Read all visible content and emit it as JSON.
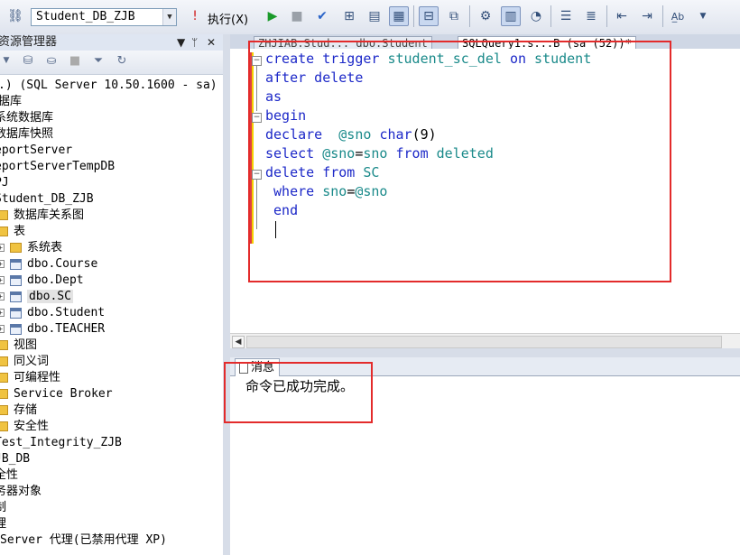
{
  "toolbar": {
    "database_selected": "Student_DB_ZJB",
    "execute_label": "执行(X)",
    "icons": [
      "connect-icon",
      "execute-icon",
      "debug-icon",
      "stop-icon",
      "parse-icon",
      "display-plan-icon",
      "query-options-icon",
      "results-grid-icon",
      "results-text-icon",
      "results-file-icon",
      "include-plan-icon",
      "client-stats-icon",
      "comment-icon",
      "uncomment-icon",
      "indent-icon",
      "outdent-icon",
      "specify-values-icon"
    ]
  },
  "object_explorer": {
    "title": "资源管理器",
    "tree": [
      {
        "label": ".) (SQL Server 10.50.1600 - sa)",
        "type": "server"
      },
      {
        "label": "据库",
        "type": "folder"
      },
      {
        "label": "系统数据库",
        "type": "folder"
      },
      {
        "label": "数据库快照",
        "type": "folder"
      },
      {
        "label": "eportServer",
        "type": "db"
      },
      {
        "label": "eportServerTempDB",
        "type": "db"
      },
      {
        "label": "PJ",
        "type": "db"
      },
      {
        "label": "Student_DB_ZJB",
        "type": "db"
      },
      {
        "label": "数据库关系图",
        "type": "folder"
      },
      {
        "label": "表",
        "type": "folder"
      },
      {
        "label": "系统表",
        "type": "folder"
      },
      {
        "label": "dbo.Course",
        "type": "table"
      },
      {
        "label": "dbo.Dept",
        "type": "table"
      },
      {
        "label": "dbo.SC",
        "type": "table",
        "selected": true
      },
      {
        "label": "dbo.Student",
        "type": "table"
      },
      {
        "label": "dbo.TEACHER",
        "type": "table"
      },
      {
        "label": "视图",
        "type": "folder"
      },
      {
        "label": "同义词",
        "type": "folder"
      },
      {
        "label": "可编程性",
        "type": "folder"
      },
      {
        "label": "Service Broker",
        "type": "folder"
      },
      {
        "label": "存储",
        "type": "folder"
      },
      {
        "label": "安全性",
        "type": "folder"
      },
      {
        "label": "Test_Integrity_ZJB",
        "type": "db"
      },
      {
        "label": "JB_DB",
        "type": "db"
      },
      {
        "label": "全性",
        "type": "folder"
      },
      {
        "label": "务器对象",
        "type": "folder"
      },
      {
        "label": "制",
        "type": "folder"
      },
      {
        "label": "理",
        "type": "folder"
      },
      {
        "label": " Server 代理(已禁用代理 XP)",
        "type": "agent"
      }
    ]
  },
  "editor_tabs": [
    {
      "label": "ZHJIAB.Stud... dbo.Student",
      "active": false
    },
    {
      "label": "SQLQuery1.s...B (sa (52))*",
      "active": true
    }
  ],
  "code": {
    "lines": [
      {
        "tokens": [
          {
            "t": "create trigger ",
            "c": "kw"
          },
          {
            "t": "student_sc_del ",
            "c": "id"
          },
          {
            "t": "on ",
            "c": "kw"
          },
          {
            "t": "student",
            "c": "id"
          }
        ]
      },
      {
        "tokens": [
          {
            "t": "after delete",
            "c": "kw"
          }
        ]
      },
      {
        "tokens": [
          {
            "t": "as",
            "c": "kw"
          }
        ]
      },
      {
        "tokens": [
          {
            "t": "begin",
            "c": "kw"
          }
        ]
      },
      {
        "tokens": [
          {
            "t": "declare  ",
            "c": "kw"
          },
          {
            "t": "@sno ",
            "c": "var"
          },
          {
            "t": "char",
            "c": "kw"
          },
          {
            "t": "(9)",
            "c": "num"
          }
        ]
      },
      {
        "tokens": [
          {
            "t": "select ",
            "c": "kw"
          },
          {
            "t": "@sno",
            "c": "var"
          },
          {
            "t": "=",
            "c": "num"
          },
          {
            "t": "sno ",
            "c": "id"
          },
          {
            "t": "from ",
            "c": "kw"
          },
          {
            "t": "deleted",
            "c": "id"
          }
        ]
      },
      {
        "tokens": [
          {
            "t": "delete ",
            "c": "kw"
          },
          {
            "t": "from ",
            "c": "kw"
          },
          {
            "t": "SC",
            "c": "id"
          }
        ]
      },
      {
        "tokens": [
          {
            "t": " where ",
            "c": "kw"
          },
          {
            "t": "sno",
            "c": "id"
          },
          {
            "t": "=",
            "c": "num"
          },
          {
            "t": "@sno",
            "c": "var"
          }
        ]
      },
      {
        "tokens": [
          {
            "t": " end",
            "c": "kw"
          }
        ]
      }
    ]
  },
  "messages": {
    "tab_label": "消息",
    "text": "命令已成功完成。"
  },
  "colors": {
    "keyword": "#1c28c8",
    "identifier": "#1a8a8a",
    "highlight_box": "#e32b2b"
  }
}
